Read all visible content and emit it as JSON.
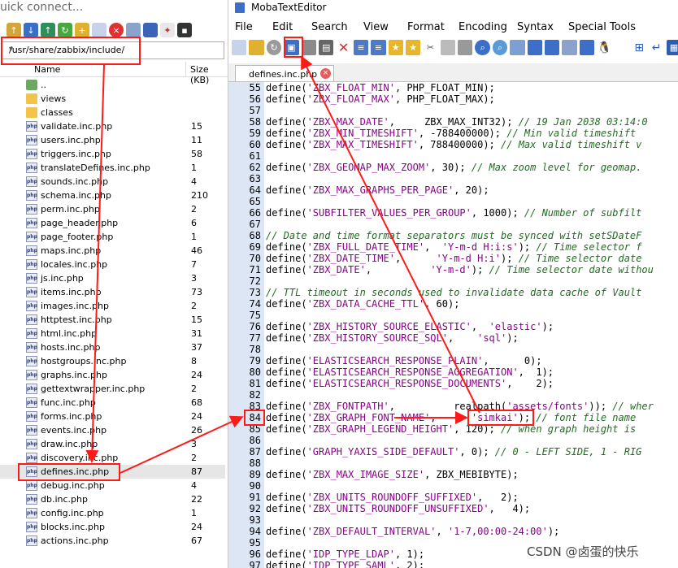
{
  "left_panel": {
    "quick_connect": "uick connect...",
    "path": "/usr/share/zabbix/include/",
    "columns": {
      "name": "Name",
      "size": "Size (KB)"
    },
    "files": [
      {
        "name": "..",
        "size": "",
        "icon": "up-folder-icon"
      },
      {
        "name": "views",
        "size": "",
        "icon": "folder-icon"
      },
      {
        "name": "classes",
        "size": "",
        "icon": "folder-icon"
      },
      {
        "name": "validate.inc.php",
        "size": "15",
        "icon": "php-file-icon"
      },
      {
        "name": "users.inc.php",
        "size": "11",
        "icon": "php-file-icon"
      },
      {
        "name": "triggers.inc.php",
        "size": "58",
        "icon": "php-file-icon"
      },
      {
        "name": "translateDefines.inc.php",
        "size": "1",
        "icon": "php-file-icon"
      },
      {
        "name": "sounds.inc.php",
        "size": "4",
        "icon": "php-file-icon"
      },
      {
        "name": "schema.inc.php",
        "size": "210",
        "icon": "php-file-icon"
      },
      {
        "name": "perm.inc.php",
        "size": "2",
        "icon": "php-file-icon"
      },
      {
        "name": "page_header.php",
        "size": "6",
        "icon": "php-file-icon"
      },
      {
        "name": "page_footer.php",
        "size": "1",
        "icon": "php-file-icon"
      },
      {
        "name": "maps.inc.php",
        "size": "46",
        "icon": "php-file-icon"
      },
      {
        "name": "locales.inc.php",
        "size": "7",
        "icon": "php-file-icon"
      },
      {
        "name": "js.inc.php",
        "size": "3",
        "icon": "php-file-icon"
      },
      {
        "name": "items.inc.php",
        "size": "73",
        "icon": "php-file-icon"
      },
      {
        "name": "images.inc.php",
        "size": "2",
        "icon": "php-file-icon"
      },
      {
        "name": "httptest.inc.php",
        "size": "15",
        "icon": "php-file-icon"
      },
      {
        "name": "html.inc.php",
        "size": "31",
        "icon": "php-file-icon"
      },
      {
        "name": "hosts.inc.php",
        "size": "37",
        "icon": "php-file-icon"
      },
      {
        "name": "hostgroups.inc.php",
        "size": "8",
        "icon": "php-file-icon"
      },
      {
        "name": "graphs.inc.php",
        "size": "24",
        "icon": "php-file-icon"
      },
      {
        "name": "gettextwrapper.inc.php",
        "size": "2",
        "icon": "php-file-icon"
      },
      {
        "name": "func.inc.php",
        "size": "68",
        "icon": "php-file-icon"
      },
      {
        "name": "forms.inc.php",
        "size": "24",
        "icon": "php-file-icon"
      },
      {
        "name": "events.inc.php",
        "size": "26",
        "icon": "php-file-icon"
      },
      {
        "name": "draw.inc.php",
        "size": "3",
        "icon": "php-file-icon"
      },
      {
        "name": "discovery.inc.php",
        "size": "2",
        "icon": "php-file-icon"
      },
      {
        "name": "defines.inc.php",
        "size": "87",
        "icon": "php-file-icon"
      },
      {
        "name": "debug.inc.php",
        "size": "4",
        "icon": "php-file-icon"
      },
      {
        "name": "db.inc.php",
        "size": "22",
        "icon": "php-file-icon"
      },
      {
        "name": "config.inc.php",
        "size": "1",
        "icon": "php-file-icon"
      },
      {
        "name": "blocks.inc.php",
        "size": "24",
        "icon": "php-file-icon"
      },
      {
        "name": "actions.inc.php",
        "size": "67",
        "icon": "php-file-icon"
      }
    ],
    "selected": "defines.inc.php"
  },
  "editor": {
    "title": "MobaTextEditor",
    "menu": [
      "File",
      "Edit",
      "Search",
      "View",
      "Format",
      "Encoding",
      "Syntax",
      "Special Tools"
    ],
    "tab_label": "defines.inc.php",
    "lines": [
      {
        "n": "55",
        "t": "define('ZBX_FLOAT_MIN', PHP_FLOAT_MIN);"
      },
      {
        "n": "56",
        "t": "define('ZBX_FLOAT_MAX', PHP_FLOAT_MAX);"
      },
      {
        "n": "57",
        "t": ""
      },
      {
        "n": "58",
        "t": "define('ZBX_MAX_DATE',     ZBX_MAX_INT32); // 19 Jan 2038 03:14:0"
      },
      {
        "n": "59",
        "t": "define('ZBX_MIN_TIMESHIFT', -788400000); // Min valid timeshift"
      },
      {
        "n": "60",
        "t": "define('ZBX_MAX_TIMESHIFT', 788400000); // Max valid timeshift v"
      },
      {
        "n": "61",
        "t": ""
      },
      {
        "n": "62",
        "t": "define('ZBX_GEOMAP_MAX_ZOOM', 30); // Max zoom level for geomap."
      },
      {
        "n": "63",
        "t": ""
      },
      {
        "n": "64",
        "t": "define('ZBX_MAX_GRAPHS_PER_PAGE', 20);"
      },
      {
        "n": "65",
        "t": ""
      },
      {
        "n": "66",
        "t": "define('SUBFILTER_VALUES_PER_GROUP', 1000); // Number of subfilt"
      },
      {
        "n": "67",
        "t": ""
      },
      {
        "n": "68",
        "t": "// Date and time format separators must be synced with setSDateF"
      },
      {
        "n": "69",
        "t": "define('ZBX_FULL_DATE_TIME',  'Y-m-d H:i:s'); // Time selector f"
      },
      {
        "n": "70",
        "t": "define('ZBX_DATE_TIME',      'Y-m-d H:i'); // Time selector date"
      },
      {
        "n": "71",
        "t": "define('ZBX_DATE',          'Y-m-d'); // Time selector date withou"
      },
      {
        "n": "72",
        "t": ""
      },
      {
        "n": "73",
        "t": "// TTL timeout in seconds used to invalidate data cache of Vault"
      },
      {
        "n": "74",
        "t": "define('ZBX_DATA_CACHE_TTL', 60);"
      },
      {
        "n": "75",
        "t": ""
      },
      {
        "n": "76",
        "t": "define('ZBX_HISTORY_SOURCE_ELASTIC',  'elastic');"
      },
      {
        "n": "77",
        "t": "define('ZBX_HISTORY_SOURCE_SQL',    'sql');"
      },
      {
        "n": "78",
        "t": ""
      },
      {
        "n": "79",
        "t": "define('ELASTICSEARCH_RESPONSE_PLAIN',      0);"
      },
      {
        "n": "80",
        "t": "define('ELASTICSEARCH_RESPONSE_AGGREGATION',  1);"
      },
      {
        "n": "81",
        "t": "define('ELASTICSEARCH_RESPONSE_DOCUMENTS',    2);"
      },
      {
        "n": "82",
        "t": ""
      },
      {
        "n": "83",
        "t": "define('ZBX_FONTPATH',          realpath('assets/fonts')); // wher"
      },
      {
        "n": "84",
        "t": "define('ZBX_GRAPH_FONT_NAME',      'simkai'); // font file name"
      },
      {
        "n": "85",
        "t": "define('ZBX_GRAPH_LEGEND_HEIGHT', 120); // when graph height is"
      },
      {
        "n": "86",
        "t": ""
      },
      {
        "n": "87",
        "t": "define('GRAPH_YAXIS_SIDE_DEFAULT', 0); // 0 - LEFT SIDE, 1 - RIG"
      },
      {
        "n": "88",
        "t": ""
      },
      {
        "n": "89",
        "t": "define('ZBX_MAX_IMAGE_SIZE', ZBX_MEBIBYTE);"
      },
      {
        "n": "90",
        "t": ""
      },
      {
        "n": "91",
        "t": "define('ZBX_UNITS_ROUNDOFF_SUFFIXED',   2);"
      },
      {
        "n": "92",
        "t": "define('ZBX_UNITS_ROUNDOFF_UNSUFFIXED',   4);"
      },
      {
        "n": "93",
        "t": ""
      },
      {
        "n": "94",
        "t": "define('ZBX_DEFAULT_INTERVAL', '1-7,00:00-24:00');"
      },
      {
        "n": "95",
        "t": ""
      },
      {
        "n": "96",
        "t": "define('IDP_TYPE_LDAP', 1);"
      },
      {
        "n": "97",
        "t": "define('IDP_TYPE_SAML', 2);"
      }
    ]
  },
  "watermark": "CSDN @卤蛋的快乐",
  "colors": {
    "annotation": "#ff1a1a",
    "gutter": "#dce6f5",
    "string": "#8b008b",
    "comment": "#1f6e1f"
  }
}
